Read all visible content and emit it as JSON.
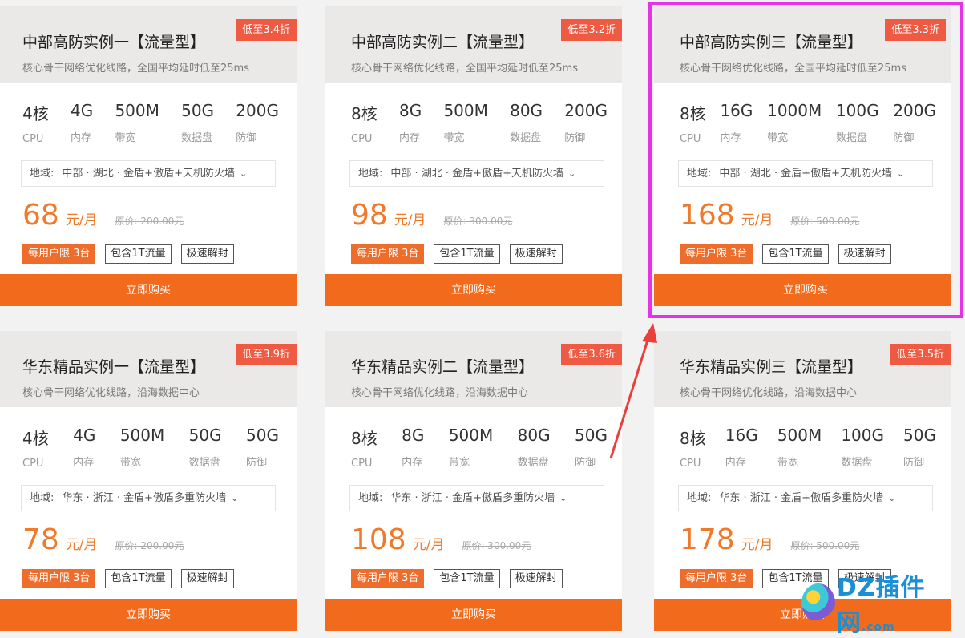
{
  "cards": [
    {
      "title": "中部高防实例一【流量型】",
      "subtitle": "核心骨干网络优化线路，全国平均延时低至25ms",
      "discount": "低至3.4折",
      "specs": [
        {
          "value": "4核",
          "label": "CPU"
        },
        {
          "value": "4G",
          "label": "内存"
        },
        {
          "value": "500M",
          "label": "带宽"
        },
        {
          "value": "50G",
          "label": "数据盘"
        },
        {
          "value": "200G",
          "label": "防御"
        }
      ],
      "region_label": "地域:",
      "region_value": "中部 · 湖北 · 金盾+傲盾+天机防火墙",
      "price": "68",
      "unit": "元/月",
      "original": "原价: 200.00元",
      "tags": [
        "每用户限 3台",
        "包含1T流量",
        "极速解封"
      ],
      "buy": "立即购买"
    },
    {
      "title": "中部高防实例二【流量型】",
      "subtitle": "核心骨干网络优化线路，全国平均延时低至25ms",
      "discount": "低至3.2折",
      "specs": [
        {
          "value": "8核",
          "label": "CPU"
        },
        {
          "value": "8G",
          "label": "内存"
        },
        {
          "value": "500M",
          "label": "带宽"
        },
        {
          "value": "80G",
          "label": "数据盘"
        },
        {
          "value": "200G",
          "label": "防御"
        }
      ],
      "region_label": "地域:",
      "region_value": "中部 · 湖北 · 金盾+傲盾+天机防火墙",
      "price": "98",
      "unit": "元/月",
      "original": "原价: 300.00元",
      "tags": [
        "每用户限 3台",
        "包含1T流量",
        "极速解封"
      ],
      "buy": "立即购买"
    },
    {
      "title": "中部高防实例三【流量型】",
      "subtitle": "核心骨干网络优化线路，全国平均延时低至25ms",
      "discount": "低至3.3折",
      "specs": [
        {
          "value": "8核",
          "label": "CPU"
        },
        {
          "value": "16G",
          "label": "内存"
        },
        {
          "value": "1000M",
          "label": "带宽"
        },
        {
          "value": "100G",
          "label": "数据盘"
        },
        {
          "value": "200G",
          "label": "防御"
        }
      ],
      "region_label": "地域:",
      "region_value": "中部 · 湖北 · 金盾+傲盾+天机防火墙",
      "price": "168",
      "unit": "元/月",
      "original": "原价: 500.00元",
      "tags": [
        "每用户限 3台",
        "包含1T流量",
        "极速解封"
      ],
      "buy": "立即购买"
    },
    {
      "title": "华东精品实例一【流量型】",
      "subtitle": "核心骨干网络优化线路，沿海数据中心",
      "discount": "低至3.9折",
      "specs": [
        {
          "value": "4核",
          "label": "CPU"
        },
        {
          "value": "4G",
          "label": "内存"
        },
        {
          "value": "500M",
          "label": "带宽"
        },
        {
          "value": "50G",
          "label": "数据盘"
        },
        {
          "value": "50G",
          "label": "防御"
        }
      ],
      "region_label": "地域:",
      "region_value": "华东 · 浙江 · 金盾+傲盾多重防火墙",
      "price": "78",
      "unit": "元/月",
      "original": "原价: 200.00元",
      "tags": [
        "每用户限 3台",
        "包含1T流量",
        "极速解封"
      ],
      "buy": "立即购买"
    },
    {
      "title": "华东精品实例二【流量型】",
      "subtitle": "核心骨干网络优化线路，沿海数据中心",
      "discount": "低至3.6折",
      "specs": [
        {
          "value": "8核",
          "label": "CPU"
        },
        {
          "value": "8G",
          "label": "内存"
        },
        {
          "value": "500M",
          "label": "带宽"
        },
        {
          "value": "80G",
          "label": "数据盘"
        },
        {
          "value": "50G",
          "label": "防御"
        }
      ],
      "region_label": "地域:",
      "region_value": "华东 · 浙江 · 金盾+傲盾多重防火墙",
      "price": "108",
      "unit": "元/月",
      "original": "原价: 300.00元",
      "tags": [
        "每用户限 3台",
        "包含1T流量",
        "极速解封"
      ],
      "buy": "立即购买"
    },
    {
      "title": "华东精品实例三【流量型】",
      "subtitle": "核心骨干网络优化线路，沿海数据中心",
      "discount": "低至3.5折",
      "specs": [
        {
          "value": "8核",
          "label": "CPU"
        },
        {
          "value": "16G",
          "label": "内存"
        },
        {
          "value": "500M",
          "label": "带宽"
        },
        {
          "value": "100G",
          "label": "数据盘"
        },
        {
          "value": "50G",
          "label": "防御"
        }
      ],
      "region_label": "地域:",
      "region_value": "华东 · 浙江 · 金盾+傲盾多重防火墙",
      "price": "178",
      "unit": "元/月",
      "original": "原价: 500.00元",
      "tags": [
        "每用户限 3台",
        "包含1T流量",
        "极速解封"
      ],
      "buy": "立即购买"
    }
  ],
  "colors": {
    "accent": "#f26b1d",
    "price": "#ee7a2a",
    "discount": "#ef5a43",
    "highlight": "#e633e6",
    "arrow": "#e8403a"
  },
  "watermark": {
    "brand": "DZ插件网",
    "tld": ".com"
  }
}
